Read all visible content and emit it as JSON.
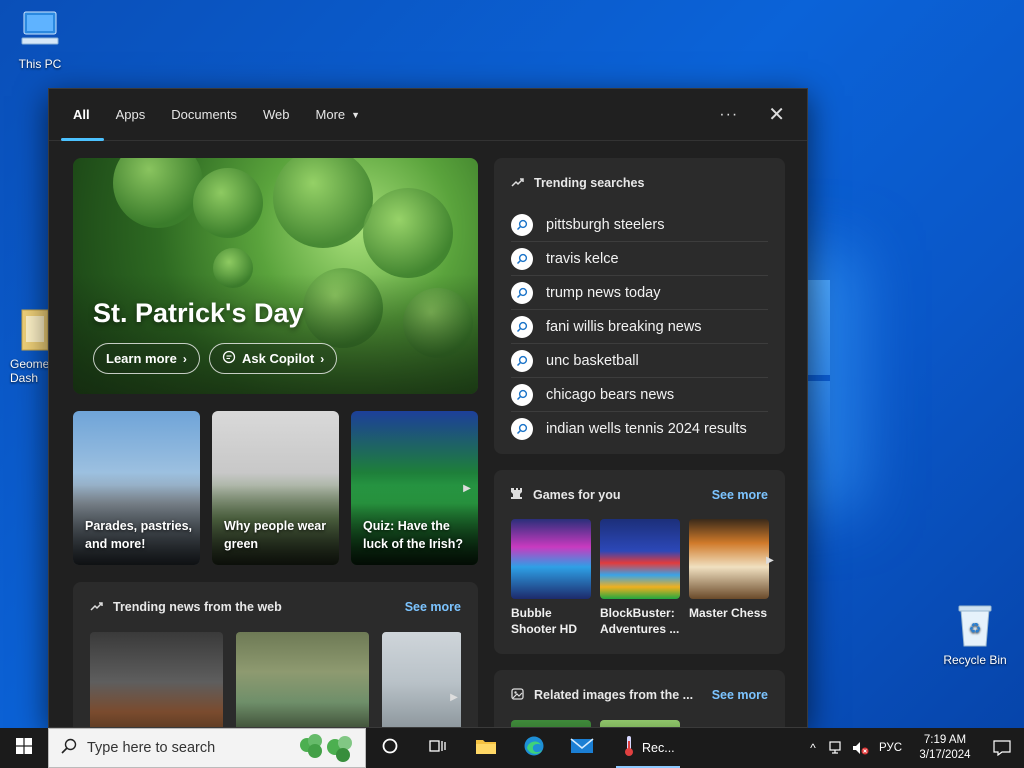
{
  "desktop": {
    "icons": [
      {
        "label": "This PC"
      },
      {
        "label": "Geome... Dash"
      },
      {
        "label": "Recycle Bin"
      }
    ]
  },
  "search_panel": {
    "tabs": [
      "All",
      "Apps",
      "Documents",
      "Web",
      "More"
    ],
    "active_tab": "All",
    "more_caret": "▼",
    "menu_icon": "···",
    "close_icon": "✕",
    "hero": {
      "title": "St. Patrick's Day",
      "learn_more": "Learn more",
      "ask_copilot": "Ask Copilot"
    },
    "cards": [
      {
        "label": "Parades, pastries, and more!"
      },
      {
        "label": "Why people wear green"
      },
      {
        "label": "Quiz: Have the luck of the Irish?"
      }
    ],
    "trending_news": {
      "title": "Trending news from the web",
      "see_more": "See more"
    },
    "trending_searches": {
      "title": "Trending searches",
      "items": [
        "pittsburgh steelers",
        "travis kelce",
        "trump news today",
        "fani willis breaking news",
        "unc basketball",
        "chicago bears news",
        "indian wells tennis 2024 results"
      ]
    },
    "games": {
      "title": "Games for you",
      "see_more": "See more",
      "items": [
        {
          "title": "Bubble Shooter HD"
        },
        {
          "title": "BlockBuster: Adventures ..."
        },
        {
          "title": "Master Chess"
        }
      ]
    },
    "related_images": {
      "title": "Related images from the ...",
      "see_more": "See more"
    }
  },
  "taskbar": {
    "search_placeholder": "Type here to search",
    "app_label": "Rec...",
    "language": "РУС",
    "time": "7:19 AM",
    "date": "3/17/2024"
  },
  "colors": {
    "accent": "#4cc2ff",
    "link": "#7cc4ff",
    "panel_bg": "#202020",
    "box_bg": "#2b2b2b"
  }
}
